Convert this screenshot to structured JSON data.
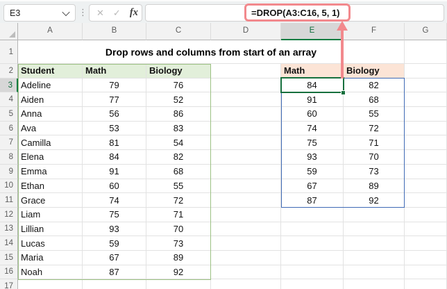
{
  "formula_bar": {
    "name_box_value": "E3",
    "formula": "=DROP(A3:C16, 5, 1)",
    "icons": {
      "cancel": "✕",
      "enter": "✓",
      "insert_function": "fx"
    },
    "separator": "⋮"
  },
  "sheet": {
    "column_headers": [
      "A",
      "B",
      "C",
      "D",
      "E",
      "F",
      "G"
    ],
    "row_headers": [
      "1",
      "2",
      "3",
      "4",
      "5",
      "6",
      "7",
      "8",
      "9",
      "10",
      "11",
      "12",
      "13",
      "14",
      "15",
      "16",
      "17"
    ],
    "selected_column": "E",
    "selected_row": "3",
    "selected_cell": "E3",
    "title": "Drop rows and columns from start of an array",
    "source_table": {
      "headers": [
        "Student",
        "Math",
        "Biology"
      ],
      "students": [
        [
          "Adeline",
          79,
          76
        ],
        [
          "Aiden",
          77,
          52
        ],
        [
          "Anna",
          56,
          86
        ],
        [
          "Ava",
          53,
          83
        ],
        [
          "Camilla",
          81,
          54
        ],
        [
          "Elena",
          84,
          82
        ],
        [
          "Emma",
          91,
          68
        ],
        [
          "Ethan",
          60,
          55
        ],
        [
          "Grace",
          74,
          72
        ],
        [
          "Liam",
          75,
          71
        ],
        [
          "Lillian",
          93,
          70
        ],
        [
          "Lucas",
          59,
          73
        ],
        [
          "Maria",
          67,
          89
        ],
        [
          "Noah",
          87,
          92
        ]
      ]
    },
    "result_range": {
      "headers": [
        "Math",
        "Biology"
      ],
      "values": [
        [
          84,
          82
        ],
        [
          91,
          68
        ],
        [
          60,
          55
        ],
        [
          74,
          72
        ],
        [
          75,
          71
        ],
        [
          93,
          70
        ],
        [
          59,
          73
        ],
        [
          67,
          89
        ],
        [
          87,
          92
        ]
      ]
    }
  },
  "colors": {
    "selection_green": "#107C41",
    "source_header_fill": "#E2EFDA",
    "result_header_fill": "#FCE4D6",
    "source_range_outline": "#9CC183",
    "spill_border_blue": "#3F6AB5",
    "annotation_pink": "#F2898D"
  }
}
